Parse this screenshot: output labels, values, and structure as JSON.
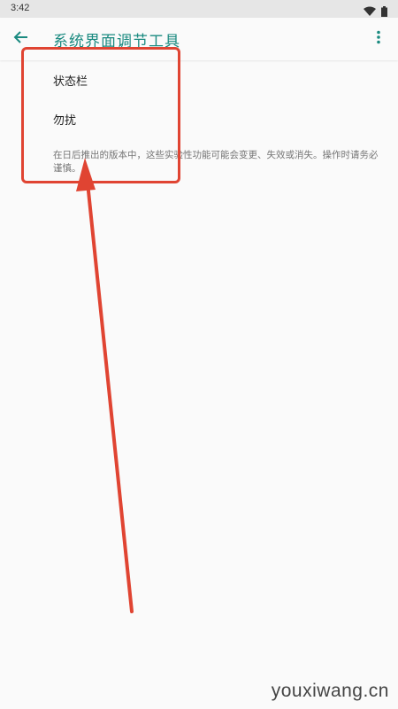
{
  "status_bar": {
    "time": "3:42",
    "icons": [
      "wifi-icon",
      "battery-icon"
    ]
  },
  "toolbar": {
    "title": "系统界面调节工具",
    "back_icon": "arrow-back-icon",
    "overflow_icon": "more-vert-icon"
  },
  "list": {
    "items": [
      {
        "label": "状态栏"
      },
      {
        "label": "勿扰"
      }
    ],
    "footer": "在日后推出的版本中，这些实验性功能可能会变更、失效或消失。操作时请务必谨慎。"
  },
  "watermark": "youxiwang.cn",
  "colors": {
    "accent": "#1a8a80",
    "annotation": "#e04432",
    "status_bar_bg": "#e6e6e6",
    "background": "#fafafa"
  }
}
